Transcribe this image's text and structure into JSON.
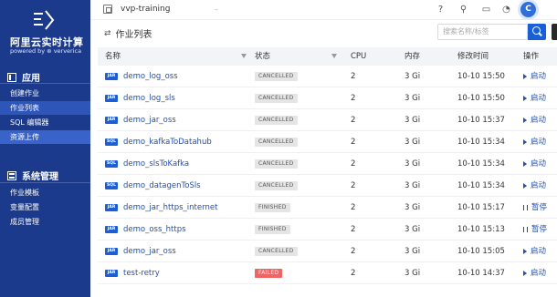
{
  "brand": {
    "title": "阿里云实时计算",
    "subtitle": "powered by ⊛ ververica"
  },
  "sidebar": {
    "sections": [
      {
        "label": "应用",
        "items": [
          "创建作业",
          "作业列表",
          "SQL 编辑器",
          "资源上传"
        ]
      },
      {
        "label": "系统管理",
        "items": [
          "作业模板",
          "变量配置",
          "成员管理"
        ]
      }
    ],
    "active_item": "作业列表"
  },
  "topbar": {
    "project": "vvp-training",
    "avatar_letter": "C"
  },
  "page": {
    "title": "作业列表",
    "search_placeholder": "搜索名称/标签"
  },
  "table": {
    "headers": {
      "name": "名称",
      "status": "状态",
      "cpu": "CPU",
      "memory": "内存",
      "modified": "修改时间",
      "action": "操作"
    },
    "rows": [
      {
        "type": "JAR",
        "name": "demo_log_oss",
        "status": "CANCELLED",
        "status_kind": "cancelled",
        "cpu": "2",
        "memory": "3 Gi",
        "modified": "10-10 15:50",
        "action": "启动",
        "action_icon": "play-icon"
      },
      {
        "type": "JAR",
        "name": "demo_log_sls",
        "status": "CANCELLED",
        "status_kind": "cancelled",
        "cpu": "2",
        "memory": "3 Gi",
        "modified": "10-10 15:50",
        "action": "启动",
        "action_icon": "play-icon"
      },
      {
        "type": "JAR",
        "name": "demo_jar_oss",
        "status": "CANCELLED",
        "status_kind": "cancelled",
        "cpu": "2",
        "memory": "3 Gi",
        "modified": "10-10 15:37",
        "action": "启动",
        "action_icon": "play-icon"
      },
      {
        "type": "SQL",
        "name": "demo_kafkaToDatahub",
        "status": "CANCELLED",
        "status_kind": "cancelled",
        "cpu": "2",
        "memory": "3 Gi",
        "modified": "10-10 15:34",
        "action": "启动",
        "action_icon": "play-icon"
      },
      {
        "type": "SQL",
        "name": "demo_slsToKafka",
        "status": "CANCELLED",
        "status_kind": "cancelled",
        "cpu": "2",
        "memory": "3 Gi",
        "modified": "10-10 15:34",
        "action": "启动",
        "action_icon": "play-icon"
      },
      {
        "type": "SQL",
        "name": "demo_datagenToSls",
        "status": "CANCELLED",
        "status_kind": "cancelled",
        "cpu": "2",
        "memory": "3 Gi",
        "modified": "10-10 15:34",
        "action": "启动",
        "action_icon": "play-icon"
      },
      {
        "type": "JAR",
        "name": "demo_jar_https_internet",
        "status": "FINISHED",
        "status_kind": "finished",
        "cpu": "2",
        "memory": "3 Gi",
        "modified": "10-10 15:17",
        "action": "暂停",
        "action_icon": "pause-icon"
      },
      {
        "type": "JAR",
        "name": "demo_oss_https",
        "status": "FINISHED",
        "status_kind": "finished",
        "cpu": "2",
        "memory": "3 Gi",
        "modified": "10-10 15:13",
        "action": "暂停",
        "action_icon": "pause-icon"
      },
      {
        "type": "JAR",
        "name": "demo_jar_oss",
        "status": "CANCELLED",
        "status_kind": "cancelled",
        "cpu": "2",
        "memory": "3 Gi",
        "modified": "10-10 15:05",
        "action": "启动",
        "action_icon": "play-icon"
      },
      {
        "type": "JAR",
        "name": "test-retry",
        "status": "FAILED",
        "status_kind": "failed",
        "cpu": "2",
        "memory": "3 Gi",
        "modified": "10-10 14:37",
        "action": "启动",
        "action_icon": "play-icon"
      }
    ]
  }
}
